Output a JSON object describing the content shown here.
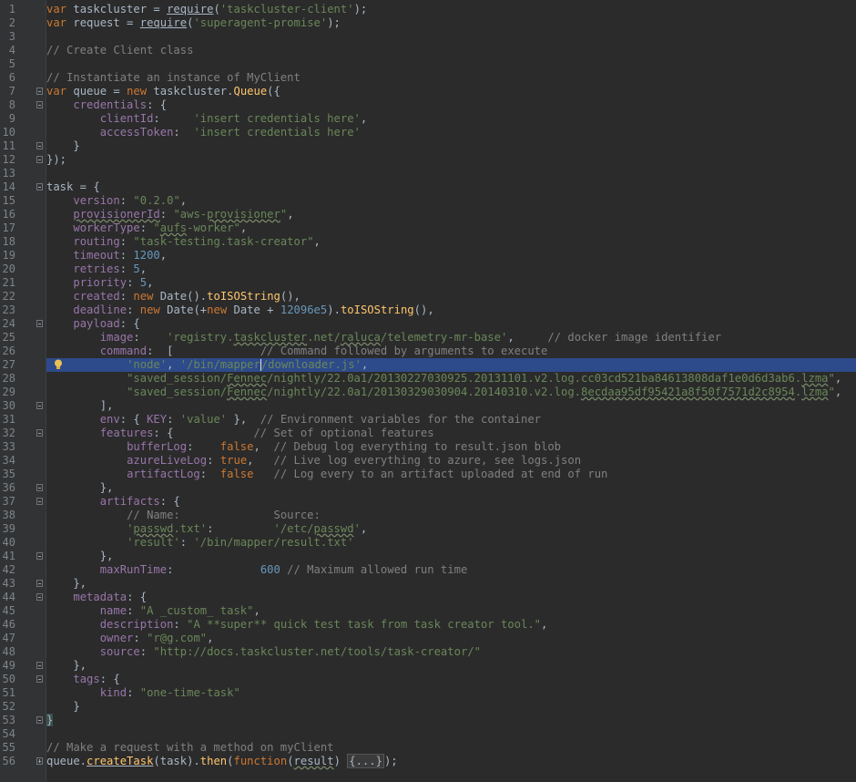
{
  "editor": {
    "current_line": 27,
    "lines": [
      {
        "n": "1",
        "t": [
          [
            "kw",
            "var "
          ],
          [
            "plain",
            "taskcluster = "
          ],
          [
            "plain_ul",
            "require"
          ],
          [
            "plain",
            "("
          ],
          [
            "str",
            "'taskcluster-client'"
          ],
          [
            "plain",
            ");"
          ]
        ]
      },
      {
        "n": "2",
        "t": [
          [
            "kw",
            "var "
          ],
          [
            "plain",
            "request = "
          ],
          [
            "plain_ul",
            "require"
          ],
          [
            "plain",
            "("
          ],
          [
            "str",
            "'superagent-promise'"
          ],
          [
            "plain",
            ");"
          ]
        ]
      },
      {
        "n": "3",
        "t": []
      },
      {
        "n": "4",
        "t": [
          [
            "cm",
            "// Create Client class"
          ]
        ]
      },
      {
        "n": "5",
        "t": []
      },
      {
        "n": "6",
        "t": [
          [
            "cm",
            "// Instantiate an instance of MyClient"
          ]
        ]
      },
      {
        "n": "7",
        "fold": "open",
        "t": [
          [
            "kw",
            "var "
          ],
          [
            "plain",
            "queue = "
          ],
          [
            "kw",
            "new "
          ],
          [
            "plain",
            "taskcluster."
          ],
          [
            "fn",
            "Queue"
          ],
          [
            "plain",
            "({"
          ]
        ]
      },
      {
        "n": "8",
        "fold": "open",
        "t": [
          [
            "plain",
            "    "
          ],
          [
            "prop",
            "credentials"
          ],
          [
            "plain",
            ": {"
          ]
        ]
      },
      {
        "n": "9",
        "t": [
          [
            "plain",
            "        "
          ],
          [
            "prop",
            "clientId"
          ],
          [
            "plain",
            ":     "
          ],
          [
            "str",
            "'insert credentials here'"
          ],
          [
            "plain",
            ","
          ]
        ]
      },
      {
        "n": "10",
        "t": [
          [
            "plain",
            "        "
          ],
          [
            "prop",
            "accessToken"
          ],
          [
            "plain",
            ":  "
          ],
          [
            "str",
            "'insert credentials here'"
          ]
        ]
      },
      {
        "n": "11",
        "fold": "open",
        "t": [
          [
            "plain",
            "    }"
          ]
        ]
      },
      {
        "n": "12",
        "fold": "open",
        "t": [
          [
            "plain",
            "});"
          ]
        ]
      },
      {
        "n": "13",
        "t": []
      },
      {
        "n": "14",
        "fold": "open",
        "t": [
          [
            "plain",
            "task = {"
          ]
        ]
      },
      {
        "n": "15",
        "t": [
          [
            "plain",
            "    "
          ],
          [
            "prop",
            "version"
          ],
          [
            "plain",
            ": "
          ],
          [
            "str",
            "\"0.2.0\""
          ],
          [
            "plain",
            ","
          ]
        ]
      },
      {
        "n": "16",
        "t": [
          [
            "plain",
            "    "
          ],
          [
            "prop_sq",
            "provisionerId"
          ],
          [
            "plain",
            ": "
          ],
          [
            "str",
            "\"aws-"
          ],
          [
            "str_sq",
            "provisioner"
          ],
          [
            "str",
            "\""
          ],
          [
            "plain",
            ","
          ]
        ]
      },
      {
        "n": "17",
        "t": [
          [
            "plain",
            "    "
          ],
          [
            "prop",
            "workerType"
          ],
          [
            "plain",
            ": "
          ],
          [
            "str",
            "\""
          ],
          [
            "str_sq",
            "aufs"
          ],
          [
            "str",
            "-worker\""
          ],
          [
            "plain",
            ","
          ]
        ]
      },
      {
        "n": "18",
        "t": [
          [
            "plain",
            "    "
          ],
          [
            "prop",
            "routing"
          ],
          [
            "plain",
            ": "
          ],
          [
            "str",
            "\"task-testing.task-creator\""
          ],
          [
            "plain",
            ","
          ]
        ]
      },
      {
        "n": "19",
        "t": [
          [
            "plain",
            "    "
          ],
          [
            "prop",
            "timeout"
          ],
          [
            "plain",
            ": "
          ],
          [
            "num",
            "1200"
          ],
          [
            "plain",
            ","
          ]
        ]
      },
      {
        "n": "20",
        "t": [
          [
            "plain",
            "    "
          ],
          [
            "prop",
            "retries"
          ],
          [
            "plain",
            ": "
          ],
          [
            "num",
            "5"
          ],
          [
            "plain",
            ","
          ]
        ]
      },
      {
        "n": "21",
        "t": [
          [
            "plain",
            "    "
          ],
          [
            "prop",
            "priority"
          ],
          [
            "plain",
            ": "
          ],
          [
            "num",
            "5"
          ],
          [
            "plain",
            ","
          ]
        ]
      },
      {
        "n": "22",
        "t": [
          [
            "plain",
            "    "
          ],
          [
            "prop",
            "created"
          ],
          [
            "plain",
            ": "
          ],
          [
            "kw",
            "new "
          ],
          [
            "plain",
            "Date()."
          ],
          [
            "fn",
            "toISOString"
          ],
          [
            "plain",
            "(),"
          ]
        ]
      },
      {
        "n": "23",
        "t": [
          [
            "plain",
            "    "
          ],
          [
            "prop",
            "deadline"
          ],
          [
            "plain",
            ": "
          ],
          [
            "kw",
            "new "
          ],
          [
            "plain",
            "Date(+"
          ],
          [
            "kw",
            "new "
          ],
          [
            "plain",
            "Date + "
          ],
          [
            "num",
            "12096e5"
          ],
          [
            "plain",
            ")."
          ],
          [
            "fn",
            "toISOString"
          ],
          [
            "plain",
            "(),"
          ]
        ]
      },
      {
        "n": "24",
        "fold": "open",
        "t": [
          [
            "plain",
            "    "
          ],
          [
            "prop",
            "payload"
          ],
          [
            "plain",
            ": {"
          ]
        ]
      },
      {
        "n": "25",
        "t": [
          [
            "plain",
            "        "
          ],
          [
            "prop",
            "image"
          ],
          [
            "plain",
            ":    "
          ],
          [
            "str",
            "'registry."
          ],
          [
            "str_sq",
            "taskcluster"
          ],
          [
            "str",
            ".net/"
          ],
          [
            "str_sq",
            "raluca"
          ],
          [
            "str",
            "/telemetry-mr-base'"
          ],
          [
            "plain",
            ",     "
          ],
          [
            "cm",
            "// docker image identifier"
          ]
        ]
      },
      {
        "n": "26",
        "t": [
          [
            "plain",
            "        "
          ],
          [
            "prop",
            "command"
          ],
          [
            "plain",
            ":  [             "
          ],
          [
            "cm",
            "// Command followed by arguments to execute"
          ]
        ]
      },
      {
        "n": "27",
        "bulb": true,
        "t": [
          [
            "plain",
            "            "
          ],
          [
            "str",
            "'node'"
          ],
          [
            "plain",
            ", "
          ],
          [
            "str",
            "'/bin/mapper"
          ],
          [
            "caret",
            ""
          ],
          [
            "str",
            "/downloader.js'"
          ],
          [
            "plain",
            ","
          ]
        ]
      },
      {
        "n": "28",
        "t": [
          [
            "plain",
            "            "
          ],
          [
            "str",
            "\"saved_session/"
          ],
          [
            "str_sq",
            "Fennec"
          ],
          [
            "str",
            "/nightly/22.0a1/20130227030925.20131101.v2.log.cc03cd521ba84613808daf1e0d6d3ab6."
          ],
          [
            "str_sq",
            "lzma"
          ],
          [
            "str",
            "\""
          ],
          [
            "plain",
            ","
          ]
        ]
      },
      {
        "n": "29",
        "t": [
          [
            "plain",
            "            "
          ],
          [
            "str",
            "\"saved_session/"
          ],
          [
            "str_sq",
            "Fennec"
          ],
          [
            "str",
            "/nightly/22.0a1/20130329030904.20140310.v2.log."
          ],
          [
            "str_sq",
            "8ecdaa95df95421a8f50f7571d2c8954"
          ],
          [
            "str",
            "."
          ],
          [
            "str_sq",
            "lzma"
          ],
          [
            "str",
            "\""
          ],
          [
            "plain",
            ","
          ]
        ]
      },
      {
        "n": "30",
        "fold": "open",
        "t": [
          [
            "plain",
            "        ],"
          ]
        ]
      },
      {
        "n": "31",
        "t": [
          [
            "plain",
            "        "
          ],
          [
            "prop",
            "env"
          ],
          [
            "plain",
            ": { "
          ],
          [
            "prop",
            "KEY"
          ],
          [
            "plain",
            ": "
          ],
          [
            "str",
            "'value'"
          ],
          [
            "plain",
            " },  "
          ],
          [
            "cm",
            "// Environment variables for the container"
          ]
        ]
      },
      {
        "n": "32",
        "fold": "open",
        "t": [
          [
            "plain",
            "        "
          ],
          [
            "prop",
            "features"
          ],
          [
            "plain",
            ": {            "
          ],
          [
            "cm",
            "// Set of optional features"
          ]
        ]
      },
      {
        "n": "33",
        "t": [
          [
            "plain",
            "            "
          ],
          [
            "prop",
            "bufferLog"
          ],
          [
            "plain",
            ":    "
          ],
          [
            "kw",
            "false"
          ],
          [
            "plain",
            ",  "
          ],
          [
            "cm",
            "// Debug log everything to result.json blob"
          ]
        ]
      },
      {
        "n": "34",
        "t": [
          [
            "plain",
            "            "
          ],
          [
            "prop",
            "azureLiveLog"
          ],
          [
            "plain",
            ": "
          ],
          [
            "kw",
            "true"
          ],
          [
            "plain",
            ",   "
          ],
          [
            "cm",
            "// Live log everything to azure, see logs.json"
          ]
        ]
      },
      {
        "n": "35",
        "t": [
          [
            "plain",
            "            "
          ],
          [
            "prop",
            "artifactLog"
          ],
          [
            "plain",
            ":  "
          ],
          [
            "kw",
            "false"
          ],
          [
            "plain",
            "   "
          ],
          [
            "cm",
            "// Log every to an artifact uploaded at end of run"
          ]
        ]
      },
      {
        "n": "36",
        "fold": "open",
        "t": [
          [
            "plain",
            "        },"
          ]
        ]
      },
      {
        "n": "37",
        "fold": "open",
        "t": [
          [
            "plain",
            "        "
          ],
          [
            "prop",
            "artifacts"
          ],
          [
            "plain",
            ": {"
          ]
        ]
      },
      {
        "n": "38",
        "t": [
          [
            "plain",
            "            "
          ],
          [
            "cm",
            "// Name:              Source:"
          ]
        ]
      },
      {
        "n": "39",
        "t": [
          [
            "plain",
            "            "
          ],
          [
            "str",
            "'"
          ],
          [
            "str_sq",
            "passwd"
          ],
          [
            "str",
            ".txt'"
          ],
          [
            "plain",
            ":         "
          ],
          [
            "str",
            "'/etc/"
          ],
          [
            "str_sq",
            "passwd"
          ],
          [
            "str",
            "'"
          ],
          [
            "plain",
            ","
          ]
        ]
      },
      {
        "n": "40",
        "t": [
          [
            "plain",
            "            "
          ],
          [
            "str",
            "'result'"
          ],
          [
            "plain",
            ": "
          ],
          [
            "str",
            "'/bin/mapper/result.txt'"
          ]
        ]
      },
      {
        "n": "41",
        "fold": "open",
        "t": [
          [
            "plain",
            "        },"
          ]
        ]
      },
      {
        "n": "42",
        "t": [
          [
            "plain",
            "        "
          ],
          [
            "prop",
            "maxRunTime"
          ],
          [
            "plain",
            ":             "
          ],
          [
            "num",
            "600"
          ],
          [
            "plain",
            " "
          ],
          [
            "cm",
            "// Maximum allowed run time"
          ]
        ]
      },
      {
        "n": "43",
        "fold": "open",
        "t": [
          [
            "plain",
            "    },"
          ]
        ]
      },
      {
        "n": "44",
        "fold": "open",
        "t": [
          [
            "plain",
            "    "
          ],
          [
            "prop",
            "metadata"
          ],
          [
            "plain",
            ": {"
          ]
        ]
      },
      {
        "n": "45",
        "t": [
          [
            "plain",
            "        "
          ],
          [
            "prop",
            "name"
          ],
          [
            "plain",
            ": "
          ],
          [
            "str",
            "\"A _custom_ task\""
          ],
          [
            "plain",
            ","
          ]
        ]
      },
      {
        "n": "46",
        "t": [
          [
            "plain",
            "        "
          ],
          [
            "prop",
            "description"
          ],
          [
            "plain",
            ": "
          ],
          [
            "str",
            "\"A **super** quick test task from task creator tool.\""
          ],
          [
            "plain",
            ","
          ]
        ]
      },
      {
        "n": "47",
        "t": [
          [
            "plain",
            "        "
          ],
          [
            "prop",
            "owner"
          ],
          [
            "plain",
            ": "
          ],
          [
            "str",
            "\"r@g.com\""
          ],
          [
            "plain",
            ","
          ]
        ]
      },
      {
        "n": "48",
        "t": [
          [
            "plain",
            "        "
          ],
          [
            "prop",
            "source"
          ],
          [
            "plain",
            ": "
          ],
          [
            "str",
            "\"http://docs.taskcluster.net/tools/task-creator/\""
          ]
        ]
      },
      {
        "n": "49",
        "fold": "open",
        "t": [
          [
            "plain",
            "    },"
          ]
        ]
      },
      {
        "n": "50",
        "fold": "open",
        "t": [
          [
            "plain",
            "    "
          ],
          [
            "prop",
            "tags"
          ],
          [
            "plain",
            ": {"
          ]
        ]
      },
      {
        "n": "51",
        "t": [
          [
            "plain",
            "        "
          ],
          [
            "prop",
            "kind"
          ],
          [
            "plain",
            ": "
          ],
          [
            "str",
            "\"one-time-task\""
          ]
        ]
      },
      {
        "n": "52",
        "t": [
          [
            "plain",
            "    }"
          ]
        ]
      },
      {
        "n": "53",
        "fold": "open",
        "t": [
          [
            "brace",
            "}"
          ]
        ]
      },
      {
        "n": "54",
        "t": []
      },
      {
        "n": "55",
        "t": [
          [
            "cm",
            "// Make a request with a method on myClient"
          ]
        ]
      },
      {
        "n": "56",
        "fold": "closed",
        "t": [
          [
            "plain",
            "queue."
          ],
          [
            "fn_ul",
            "createTask"
          ],
          [
            "plain",
            "(task)."
          ],
          [
            "fn",
            "then"
          ],
          [
            "plain",
            "("
          ],
          [
            "kw",
            "function"
          ],
          [
            "plain",
            "("
          ],
          [
            "plain_sq",
            "result"
          ],
          [
            "plain",
            ") "
          ],
          [
            "foldtxt",
            "{...}"
          ],
          [
            "plain",
            ");"
          ]
        ]
      }
    ]
  }
}
